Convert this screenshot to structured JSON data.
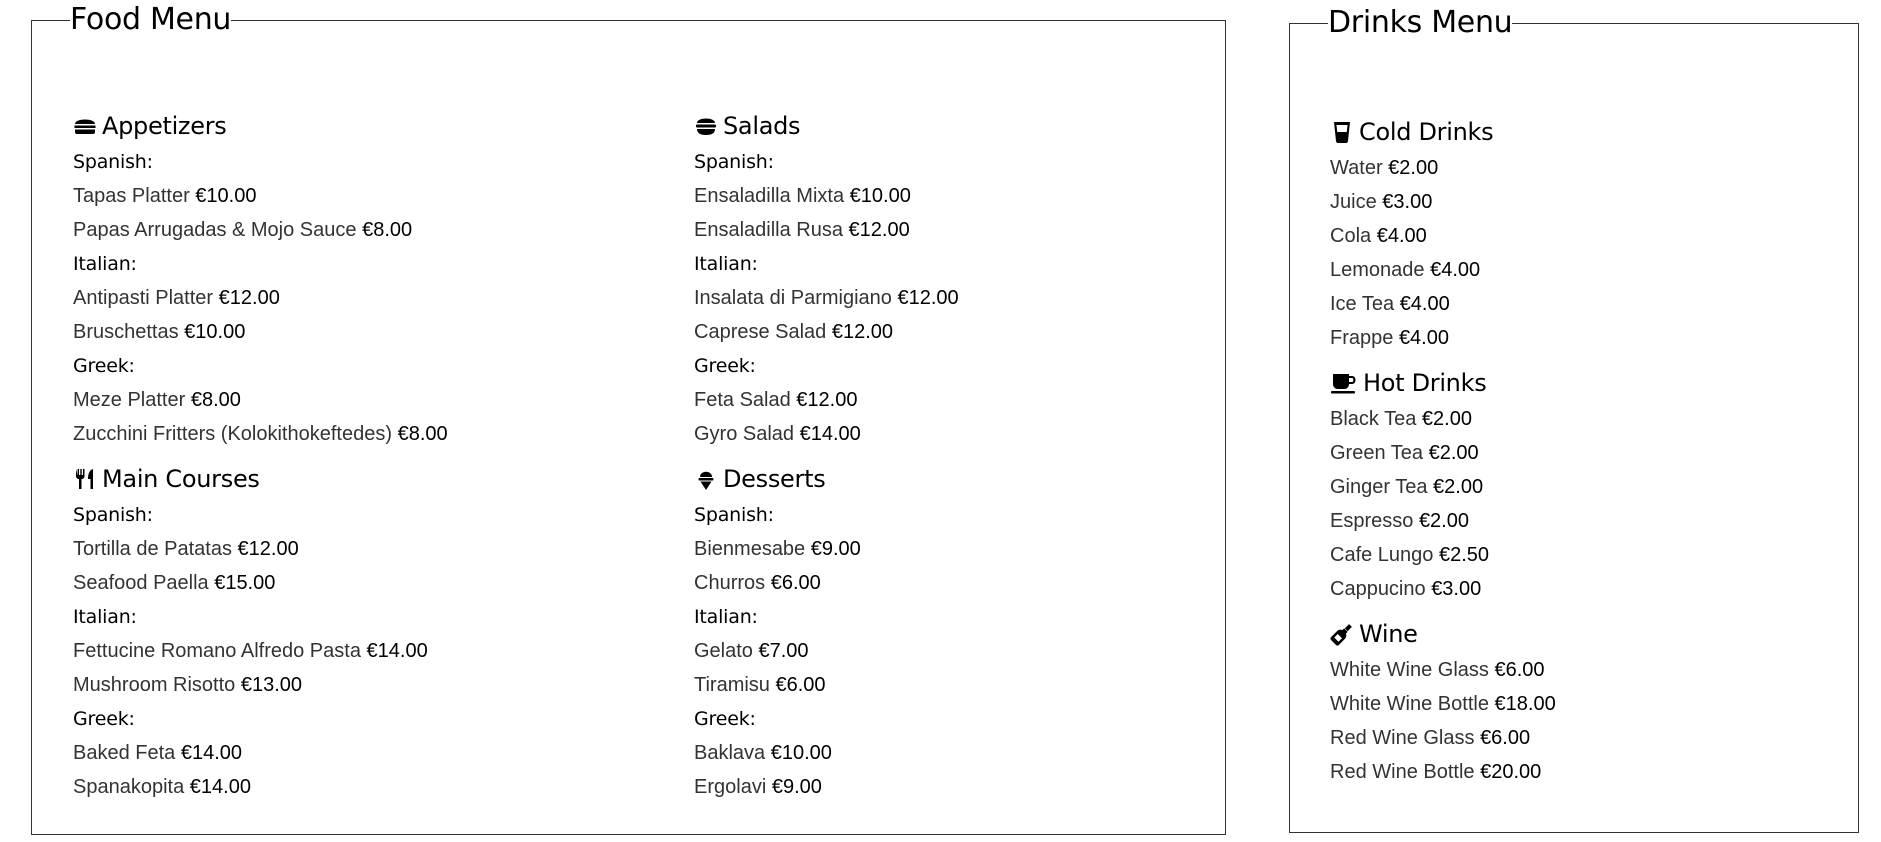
{
  "food": {
    "title": "Food Menu",
    "sections": {
      "appetizers": {
        "title": "Appetizers",
        "icon": "burger-icon",
        "groups": [
          {
            "label": "Spanish:",
            "items": [
              {
                "name": "Tapas Platter",
                "price": "€10.00"
              },
              {
                "name": "Papas Arrugadas & Mojo Sauce",
                "price": "€8.00"
              }
            ]
          },
          {
            "label": "Italian:",
            "items": [
              {
                "name": "Antipasti Platter",
                "price": "€12.00"
              },
              {
                "name": "Bruschettas",
                "price": "€10.00"
              }
            ]
          },
          {
            "label": "Greek:",
            "items": [
              {
                "name": "Meze Platter",
                "price": "€8.00"
              },
              {
                "name": "Zucchini Fritters (Kolokithokeftedes)",
                "price": "€8.00"
              }
            ]
          }
        ]
      },
      "main_courses": {
        "title": "Main Courses",
        "icon": "utensils-icon",
        "groups": [
          {
            "label": "Spanish:",
            "items": [
              {
                "name": "Tortilla de Patatas",
                "price": "€12.00"
              },
              {
                "name": "Seafood Paella",
                "price": "€15.00"
              }
            ]
          },
          {
            "label": "Italian:",
            "items": [
              {
                "name": "Fettucine Romano Alfredo Pasta",
                "price": "€14.00"
              },
              {
                "name": "Mushroom Risotto",
                "price": "€13.00"
              }
            ]
          },
          {
            "label": "Greek:",
            "items": [
              {
                "name": "Baked Feta",
                "price": "€14.00"
              },
              {
                "name": "Spanakopita",
                "price": "€14.00"
              }
            ]
          }
        ]
      },
      "salads": {
        "title": "Salads",
        "icon": "salad-icon",
        "groups": [
          {
            "label": "Spanish:",
            "items": [
              {
                "name": "Ensaladilla Mixta",
                "price": "€10.00"
              },
              {
                "name": "Ensaladilla Rusa",
                "price": "€12.00"
              }
            ]
          },
          {
            "label": "Italian:",
            "items": [
              {
                "name": "Insalata di Parmigiano",
                "price": "€12.00"
              },
              {
                "name": "Caprese Salad",
                "price": "€12.00"
              }
            ]
          },
          {
            "label": "Greek:",
            "items": [
              {
                "name": "Feta Salad",
                "price": "€12.00"
              },
              {
                "name": "Gyro Salad",
                "price": "€14.00"
              }
            ]
          }
        ]
      },
      "desserts": {
        "title": "Desserts",
        "icon": "ice-cream-icon",
        "groups": [
          {
            "label": "Spanish:",
            "items": [
              {
                "name": "Bienmesabe",
                "price": "€9.00"
              },
              {
                "name": "Churros",
                "price": "€6.00"
              }
            ]
          },
          {
            "label": "Italian:",
            "items": [
              {
                "name": "Gelato",
                "price": "€7.00"
              },
              {
                "name": "Tiramisu",
                "price": "€6.00"
              }
            ]
          },
          {
            "label": "Greek:",
            "items": [
              {
                "name": "Baklava",
                "price": "€10.00"
              },
              {
                "name": "Ergolavi",
                "price": "€9.00"
              }
            ]
          }
        ]
      }
    }
  },
  "drinks": {
    "title": "Drinks Menu",
    "sections": {
      "cold": {
        "title": "Cold Drinks",
        "icon": "glass-icon",
        "items": [
          {
            "name": "Water",
            "price": "€2.00"
          },
          {
            "name": "Juice",
            "price": "€3.00"
          },
          {
            "name": "Cola",
            "price": "€4.00"
          },
          {
            "name": "Lemonade",
            "price": "€4.00"
          },
          {
            "name": "Ice Tea",
            "price": "€4.00"
          },
          {
            "name": "Frappe",
            "price": "€4.00"
          }
        ]
      },
      "hot": {
        "title": "Hot Drinks",
        "icon": "mug-icon",
        "items": [
          {
            "name": "Black Tea",
            "price": "€2.00"
          },
          {
            "name": "Green Tea",
            "price": "€2.00"
          },
          {
            "name": "Ginger Tea",
            "price": "€2.00"
          },
          {
            "name": "Espresso",
            "price": "€2.00"
          },
          {
            "name": "Cafe Lungo",
            "price": "€2.50"
          },
          {
            "name": "Cappucino",
            "price": "€3.00"
          }
        ]
      },
      "wine": {
        "title": "Wine",
        "icon": "wine-bottle-icon",
        "items": [
          {
            "name": "White Wine Glass",
            "price": "€6.00"
          },
          {
            "name": "White Wine Bottle",
            "price": "€18.00"
          },
          {
            "name": "Red Wine Glass",
            "price": "€6.00"
          },
          {
            "name": "Red Wine Bottle",
            "price": "€20.00"
          }
        ]
      }
    }
  }
}
